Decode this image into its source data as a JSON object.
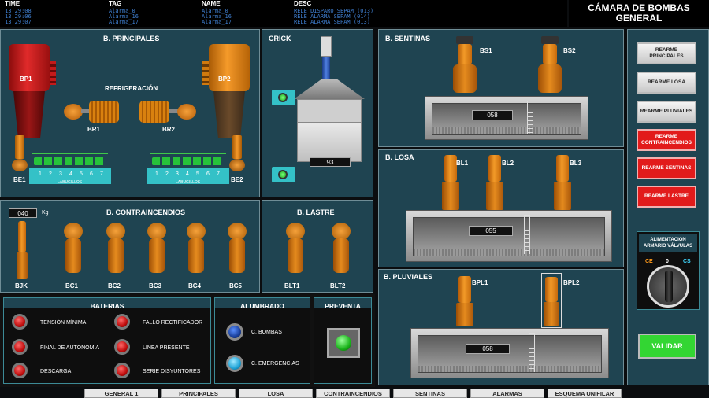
{
  "alarms": {
    "headers": {
      "time": "TIME",
      "tag": "TAG",
      "name": "NAME",
      "desc": "DESC"
    },
    "rows": [
      {
        "time": "13:29:08",
        "tag": "Alarma_0",
        "name": "Alarma_0",
        "desc": "RELE DISPARO SEPAM (013)"
      },
      {
        "time": "13:29:06",
        "tag": "Alarma_16",
        "name": "Alarma_16",
        "desc": "RELE ALARMA SEPAM (014)"
      },
      {
        "time": "13:29:07",
        "tag": "Alarma_17",
        "name": "Alarma_17",
        "desc": "RELE ALARMA SEPAM (013)"
      }
    ]
  },
  "title": {
    "line1": "CÁMARA DE BOMBAS",
    "line2": "GENERAL"
  },
  "principales": {
    "title": "B. PRINCIPALES",
    "refrigeracion": "REFRIGERACIÓN",
    "bp1": "BP1",
    "bp2": "BP2",
    "br1": "BR1",
    "br2": "BR2",
    "be1": "BE1",
    "be2": "BE2",
    "manifold_label": "LABUGILLOS",
    "nums": [
      "1",
      "2",
      "3",
      "4",
      "5",
      "6",
      "7"
    ]
  },
  "crick": {
    "title": "CRICK",
    "value": "93"
  },
  "sentinas": {
    "title": "B. SENTINAS",
    "bs1": "BS1",
    "bs2": "BS2",
    "value": "058"
  },
  "losa": {
    "title": "B. LOSA",
    "bl1": "BL1",
    "bl2": "BL2",
    "bl3": "BL3",
    "value": "055"
  },
  "pluviales": {
    "title": "B. PLUVIALES",
    "bpl1": "BPL1",
    "bpl2": "BPL2",
    "value": "058"
  },
  "contraincendios": {
    "title": "B. CONTRAINCENDIOS",
    "level": "040",
    "unit": "Kg",
    "bjk": "BJK",
    "pumps": [
      "BC1",
      "BC2",
      "BC3",
      "BC4",
      "BC5"
    ]
  },
  "lastre": {
    "title": "B. LASTRE",
    "pumps": [
      "BLT1",
      "BLT2"
    ]
  },
  "baterias": {
    "title": "BATERIAS",
    "left": [
      "TENSIÓN MÍNIMA",
      "FINAL DE AUTONOMIA",
      "DESCARGA"
    ],
    "right": [
      "FALLO RECTIFICADOR",
      "LINEA PRESENTE",
      "SERIE DISYUNTORES"
    ]
  },
  "alumbrado": {
    "title": "ALUMBRADO",
    "items": [
      "C. BOMBAS",
      "C. EMERGENCIAS"
    ]
  },
  "preventa": {
    "title": "PREVENTA"
  },
  "side": {
    "buttons": [
      {
        "label": "REARME PRINCIPALES",
        "color": "grey"
      },
      {
        "label": "REARME LOSA",
        "color": "grey"
      },
      {
        "label": "REARME PLUVIALES",
        "color": "grey"
      },
      {
        "label": "REARME CONTRAINCENDIOS",
        "color": "red"
      },
      {
        "label": "REARME SENTINAS",
        "color": "red"
      },
      {
        "label": "REARME LASTRE",
        "color": "red"
      }
    ],
    "valvulas_label": "ALIMENTACION ARMARIO VÁLVULAS",
    "selector": {
      "ce": "CE",
      "zero": "0",
      "cs": "CS"
    },
    "validar": "VALIDAR"
  },
  "tabs": [
    "GENERAL 1",
    "PRINCIPALES",
    "LOSA",
    "CONTRAINCENDIOS",
    "SENTINAS",
    "ALARMAS",
    "ESQUEMA UNIFILAR"
  ],
  "colors": {
    "panel": "#1f4451",
    "accent_red": "#e21b1b",
    "accent_green": "#2fd12f",
    "tag_blue": "#3f7fd1"
  }
}
